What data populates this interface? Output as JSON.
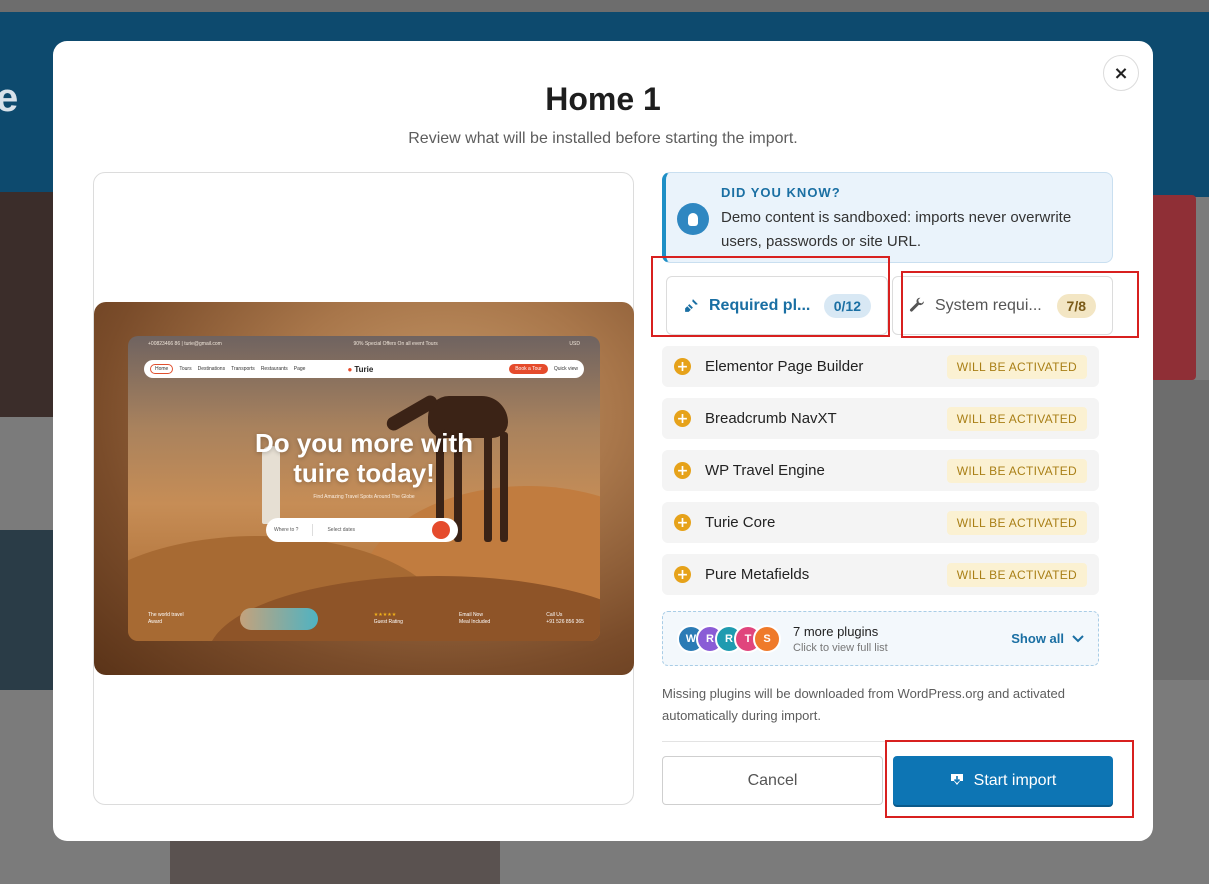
{
  "modal": {
    "title": "Home 1",
    "subtitle": "Review what will be installed before starting the import.",
    "close_label": "×"
  },
  "preview": {
    "top_contact": "+00823466 86",
    "top_email": "turie@gmail.com",
    "top_promo": "90% Special Offers On all event Tours",
    "top_currency": "USD",
    "nav": [
      "Home",
      "Tours",
      "Destinations",
      "Transports",
      "Restaurants",
      "Page"
    ],
    "logo": "Turie",
    "book_button": "Book a Tour",
    "quick_view": "Quick view",
    "headline_line1": "Do you more with",
    "headline_line2": "tuire today!",
    "tagline": "Find Amazing Travel Spots Around The Globe",
    "search_where": "Where to ?",
    "search_dates": "Select dates",
    "footer_award_l1": "The world travel",
    "footer_award_l2": "Award",
    "footer_stars": "★★★★★",
    "footer_rating": "Guest Rating",
    "footer_meal_l1": "Email Now",
    "footer_meal_l2": "Meal Included",
    "footer_call_l1": "Call Us",
    "footer_call_l2": "+91 526 856 365"
  },
  "did_you_know": {
    "title": "DID YOU KNOW?",
    "text": "Demo content is sandboxed: imports never overwrite users, passwords or site URL."
  },
  "tabs": {
    "required": {
      "label": "Required pl...",
      "count": "0/12"
    },
    "system": {
      "label": "System requi...",
      "count": "7/8"
    }
  },
  "plugins": [
    {
      "name": "Elementor Page Builder",
      "status": "WILL BE ACTIVATED"
    },
    {
      "name": "Breadcrumb NavXT",
      "status": "WILL BE ACTIVATED"
    },
    {
      "name": "WP Travel Engine",
      "status": "WILL BE ACTIVATED"
    },
    {
      "name": "Turie Core",
      "status": "WILL BE ACTIVATED"
    },
    {
      "name": "Pure Metafields",
      "status": "WILL BE ACTIVATED"
    }
  ],
  "more_plugins": {
    "avatars": [
      {
        "letter": "W",
        "color": "#2b7bb5"
      },
      {
        "letter": "R",
        "color": "#8a5cd6"
      },
      {
        "letter": "R",
        "color": "#1f9bb0"
      },
      {
        "letter": "T",
        "color": "#e0457d"
      },
      {
        "letter": "S",
        "color": "#ef7a2a"
      }
    ],
    "title": "7 more plugins",
    "subtitle": "Click to view full list",
    "show_all": "Show all"
  },
  "note": "Missing plugins will be downloaded from WordPress.org and activated automatically during import.",
  "buttons": {
    "cancel": "Cancel",
    "start": "Start import"
  },
  "colors": {
    "accent": "#0d75b4",
    "highlight": "#d8201f",
    "badge_text": "#a97f16",
    "plus_icon": "#e6a21a"
  }
}
